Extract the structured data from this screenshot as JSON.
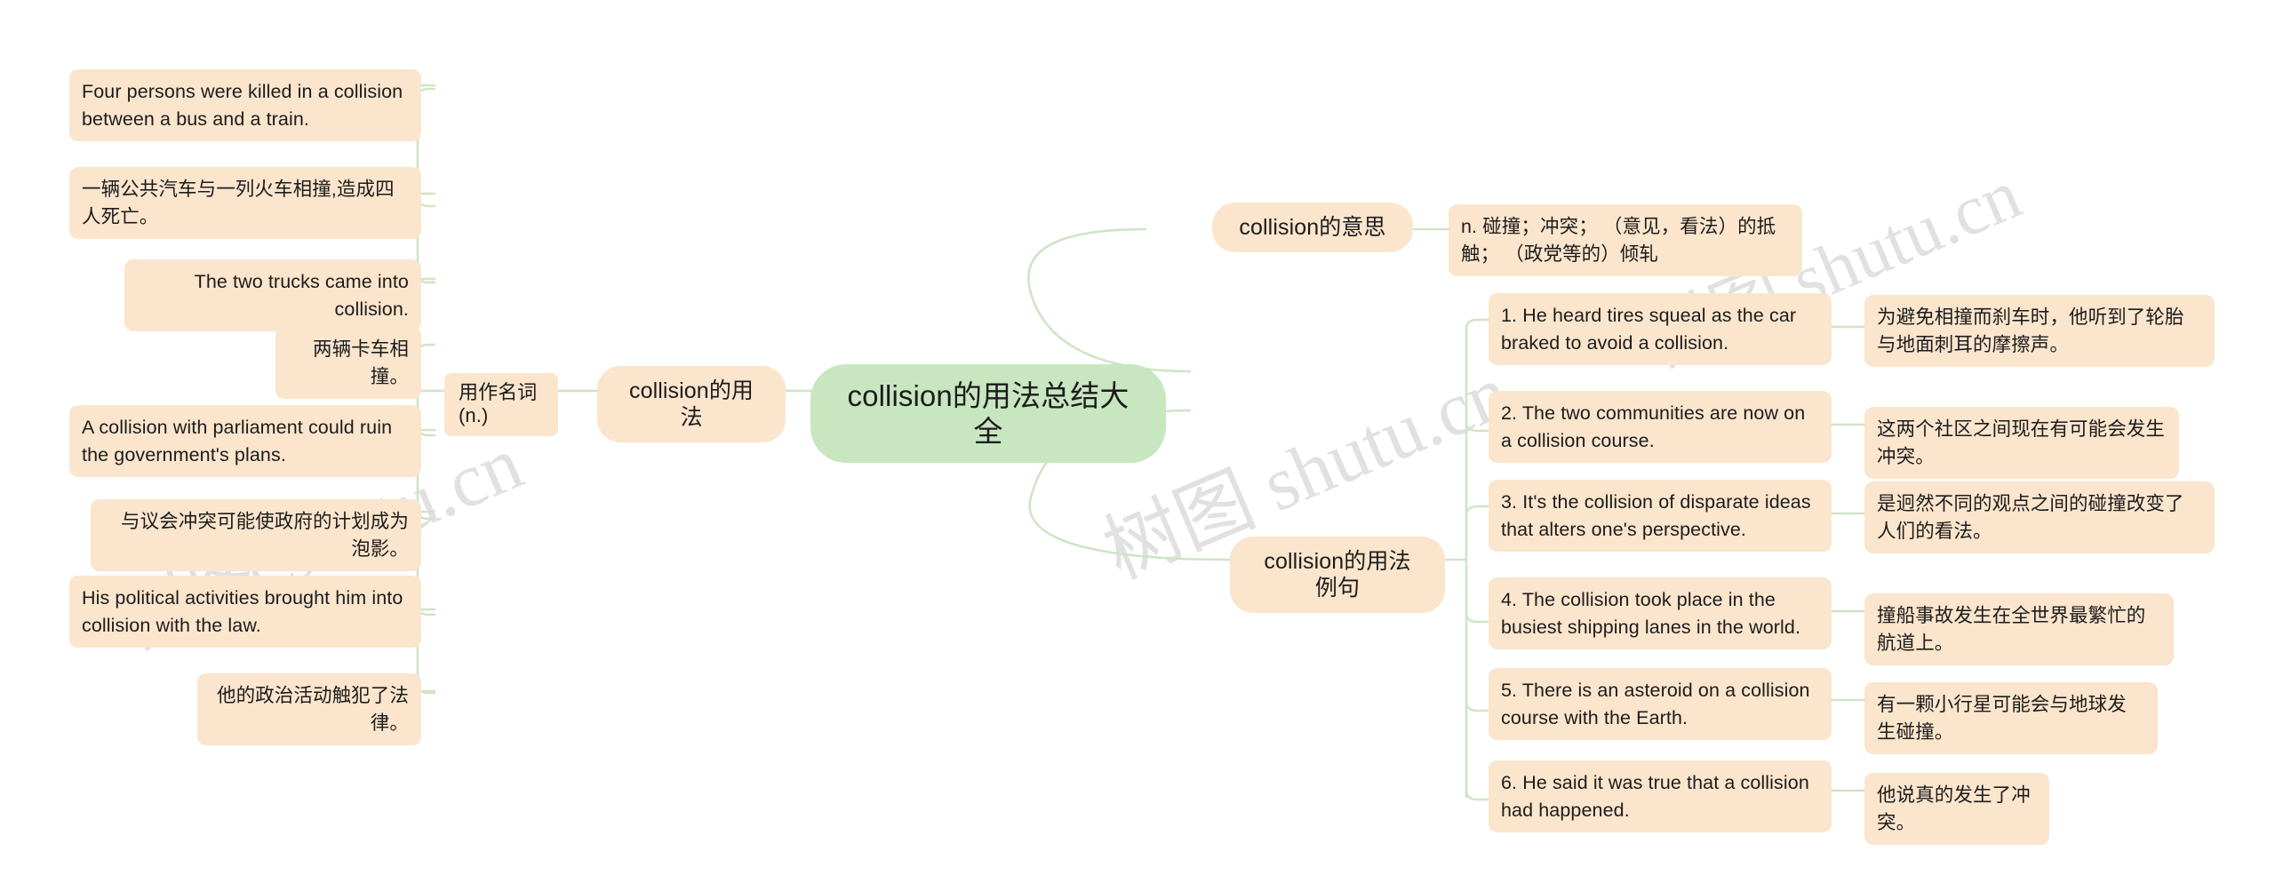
{
  "watermark": {
    "text": "树图 shutu.cn"
  },
  "root": {
    "label": "collision的用法总结大全",
    "color": "#c8e6c0"
  },
  "node_color": "#fbe5cd",
  "edge_color": "#cfe5c6",
  "branches": {
    "usage": {
      "label": "collision的用法",
      "sub": {
        "label": "用作名词(n.)",
        "leaves": [
          {
            "text": "Four persons were killed in a collision between a bus and a train."
          },
          {
            "text": "一辆公共汽车与一列火车相撞,造成四人死亡。"
          },
          {
            "text": "The two trucks came into collision."
          },
          {
            "text": "两辆卡车相撞。"
          },
          {
            "text": "A collision with parliament could ruin the government's plans."
          },
          {
            "text": "与议会冲突可能使政府的计划成为泡影。"
          },
          {
            "text": "His political activities brought him into collision with the law."
          },
          {
            "text": "他的政治活动触犯了法律。"
          }
        ]
      }
    },
    "meaning": {
      "label": "collision的意思",
      "definition": "n. 碰撞；冲突； （意见，看法）的抵触； （政党等的）倾轧"
    },
    "examples": {
      "label": "collision的用法例句",
      "items": [
        {
          "en": "1. He heard tires squeal as the car braked to avoid a collision.",
          "zh": "为避免相撞而刹车时，他听到了轮胎与地面刺耳的摩擦声。"
        },
        {
          "en": "2. The two communities are now on a collision course.",
          "zh": "这两个社区之间现在有可能会发生冲突。"
        },
        {
          "en": "3. It's the collision of disparate ideas that alters one's perspective.",
          "zh": "是迥然不同的观点之间的碰撞改变了人们的看法。"
        },
        {
          "en": "4. The collision took place in the busiest shipping lanes in the world.",
          "zh": "撞船事故发生在全世界最繁忙的航道上。"
        },
        {
          "en": "5. There is an asteroid on a collision course with the Earth.",
          "zh": "有一颗小行星可能会与地球发生碰撞。"
        },
        {
          "en": "6. He said it was true that a collision had happened.",
          "zh": "他说真的发生了冲突。"
        }
      ]
    }
  }
}
